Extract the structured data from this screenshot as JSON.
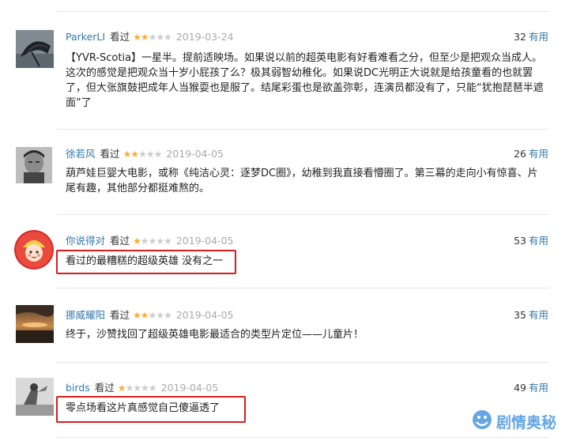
{
  "colors": {
    "link": "#3377aa",
    "star_on": "#ffac2d",
    "star_off": "#cccccc",
    "highlight_box": "#d61e1e",
    "watermark": "#5a9fe0"
  },
  "reviews": [
    {
      "user": "ParkerLI",
      "action": "看过",
      "rating": 2,
      "date": "2019-03-24",
      "votes": "32",
      "votes_label": "有用",
      "lines": [
        "【YVR-Scotia】一星半。提前适映场。如果说以前的超英电影有好看难看之分，但至少是把观众当成人。",
        "这次的感觉是把观众当十岁小屁孩了么？极其弱智幼稚化。如果说DC光明正大说就是给孩童看的也就罢",
        "了，但大张旗鼓把成年人当猴耍也是服了。结尾彩蛋也是欲盖弥彰，连演员都没有了，只能“犹抱琵琶半遮",
        "面”了"
      ]
    },
    {
      "user": "徐若风",
      "action": "看过",
      "rating": 2,
      "date": "2019-04-05",
      "votes": "26",
      "votes_label": "有用",
      "lines": [
        "葫芦娃巨婴大电影，或称《纯洁心灵：逐梦DC圈》，幼稚到我直接看懵圈了。第三幕的走向小有惊喜、片",
        "尾有趣，其他部分都挺难熬的。"
      ]
    },
    {
      "user": "你说得对",
      "action": "看过",
      "rating": 1,
      "date": "2019-04-05",
      "votes": "53",
      "votes_label": "有用",
      "lines": [
        "看过的最糟糕的超级英雄 没有之一"
      ]
    },
    {
      "user": "挪威耀阳",
      "action": "看过",
      "rating": 2,
      "date": "2019-04-05",
      "votes": "35",
      "votes_label": "有用",
      "lines": [
        "终于，沙赞找回了超级英雄电影最适合的类型片定位——儿童片！"
      ]
    },
    {
      "user": "birds",
      "action": "看过",
      "rating": 1,
      "date": "2019-04-05",
      "votes": "49",
      "votes_label": "有用",
      "lines": [
        "零点场看这片真感觉自己傻逼透了"
      ]
    }
  ],
  "watermark": {
    "icon": "mascot-icon",
    "text": "剧情奥秘"
  }
}
